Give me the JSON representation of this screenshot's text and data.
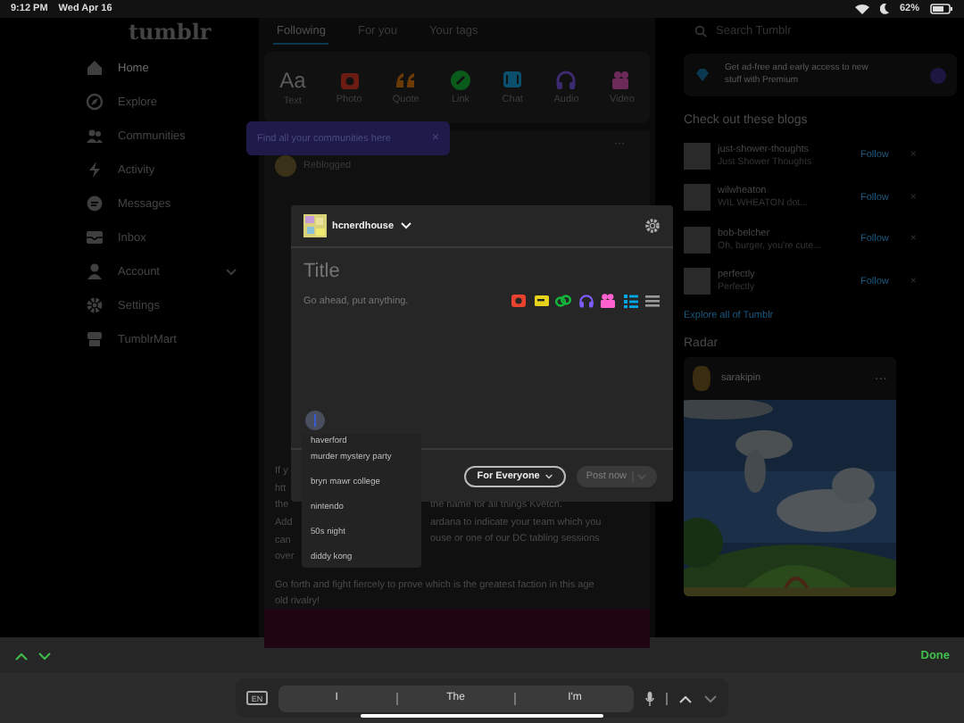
{
  "status_bar": {
    "time": "9:12 PM",
    "date": "Wed Apr 16",
    "battery": "62%"
  },
  "sidebar": {
    "logo": "tumblr",
    "items": [
      {
        "label": "Home",
        "kind": "link",
        "selected": true
      },
      {
        "label": "Explore",
        "kind": "link",
        "selected": false
      },
      {
        "label": "Communities",
        "kind": "link",
        "selected": false
      },
      {
        "label": "Activity",
        "kind": "link",
        "selected": false
      },
      {
        "label": "Messages",
        "kind": "link",
        "selected": false
      },
      {
        "label": "Inbox",
        "kind": "link",
        "selected": false
      },
      {
        "label": "Account",
        "kind": "group",
        "selected": false
      },
      {
        "label": "Settings",
        "kind": "link",
        "selected": false
      },
      {
        "label": "TumblrMart",
        "kind": "link",
        "selected": false
      }
    ]
  },
  "tabs": [
    {
      "label": "Following",
      "selected": true
    },
    {
      "label": "For you",
      "selected": false
    },
    {
      "label": "Your tags",
      "selected": false
    }
  ],
  "post_types": [
    {
      "label": "Text",
      "glyph": "Aa",
      "color": "#5a5a5a"
    },
    {
      "label": "Photo",
      "color": "#6b1d14"
    },
    {
      "label": "Quote",
      "color": "#6b3a05"
    },
    {
      "label": "Link",
      "color": "#0a5a1c"
    },
    {
      "label": "Chat",
      "color": "#0a4f6b"
    },
    {
      "label": "Audio",
      "color": "#3b2a70"
    },
    {
      "label": "Video",
      "color": "#6b2a57"
    }
  ],
  "tooltip": {
    "text": "Find all your communities here",
    "close": "×"
  },
  "post": {
    "status": "Reblogged",
    "lines_left": [
      "If y",
      "htt",
      "the",
      "Add",
      "can",
      "over"
    ],
    "lines_right": [
      "the name for all things Kvetch.",
      "ardana to indicate your team which you",
      "ouse or one of our DC tabling sessions"
    ],
    "closing": "Go forth and fight fiercely to prove which is the greatest faction in this age old rivalry!"
  },
  "right": {
    "search": {
      "placeholder": "Search Tumblr"
    },
    "premium": "Get ad-free and early access to new stuff with Premium",
    "blogs_title": "Check out these blogs",
    "blogs": [
      {
        "name": "just-shower-thoughts",
        "title": "Just Shower Thoughts",
        "action": "Follow"
      },
      {
        "name": "wilwheaton",
        "title": "WIL WHEATON dot...",
        "action": "Follow"
      },
      {
        "name": "bob-belcher",
        "title": "Oh, burger, you're cute...",
        "action": "Follow"
      },
      {
        "name": "perfectly",
        "title": "Perfectly",
        "action": "Follow"
      }
    ],
    "explore": "Explore all of Tumblr",
    "radar_title": "Radar",
    "radar_user": "sarakipin",
    "radar_more": "···"
  },
  "composer": {
    "blog": "hcnerdhouse",
    "title_placeholder": "Title",
    "body_placeholder": "Go ahead, put anything.",
    "tools": [
      {
        "color": "#e8422e"
      },
      {
        "color": "#e6d21a"
      },
      {
        "color": "#13b53a"
      },
      {
        "color": "#7c5cff"
      },
      {
        "color": "#ff62ce"
      },
      {
        "color": "#00a8e6"
      },
      {
        "color": "#9a9a9a"
      }
    ],
    "audience": "For Everyone",
    "post_button": {
      "label": "Post now",
      "disabled": true
    }
  },
  "suggestions": {
    "items": [
      {
        "label": "haverford",
        "selected": false
      },
      {
        "label": "murder mystery party",
        "selected": false
      },
      {
        "label": "bryn mawr college",
        "selected": false
      },
      {
        "label": "nintendo",
        "selected": false
      },
      {
        "label": "50s night",
        "selected": false
      },
      {
        "label": "diddy kong",
        "selected": false
      }
    ]
  },
  "keyboard": {
    "done": "Done",
    "language": "EN",
    "predictions": [
      "I",
      "The",
      "I'm"
    ]
  }
}
